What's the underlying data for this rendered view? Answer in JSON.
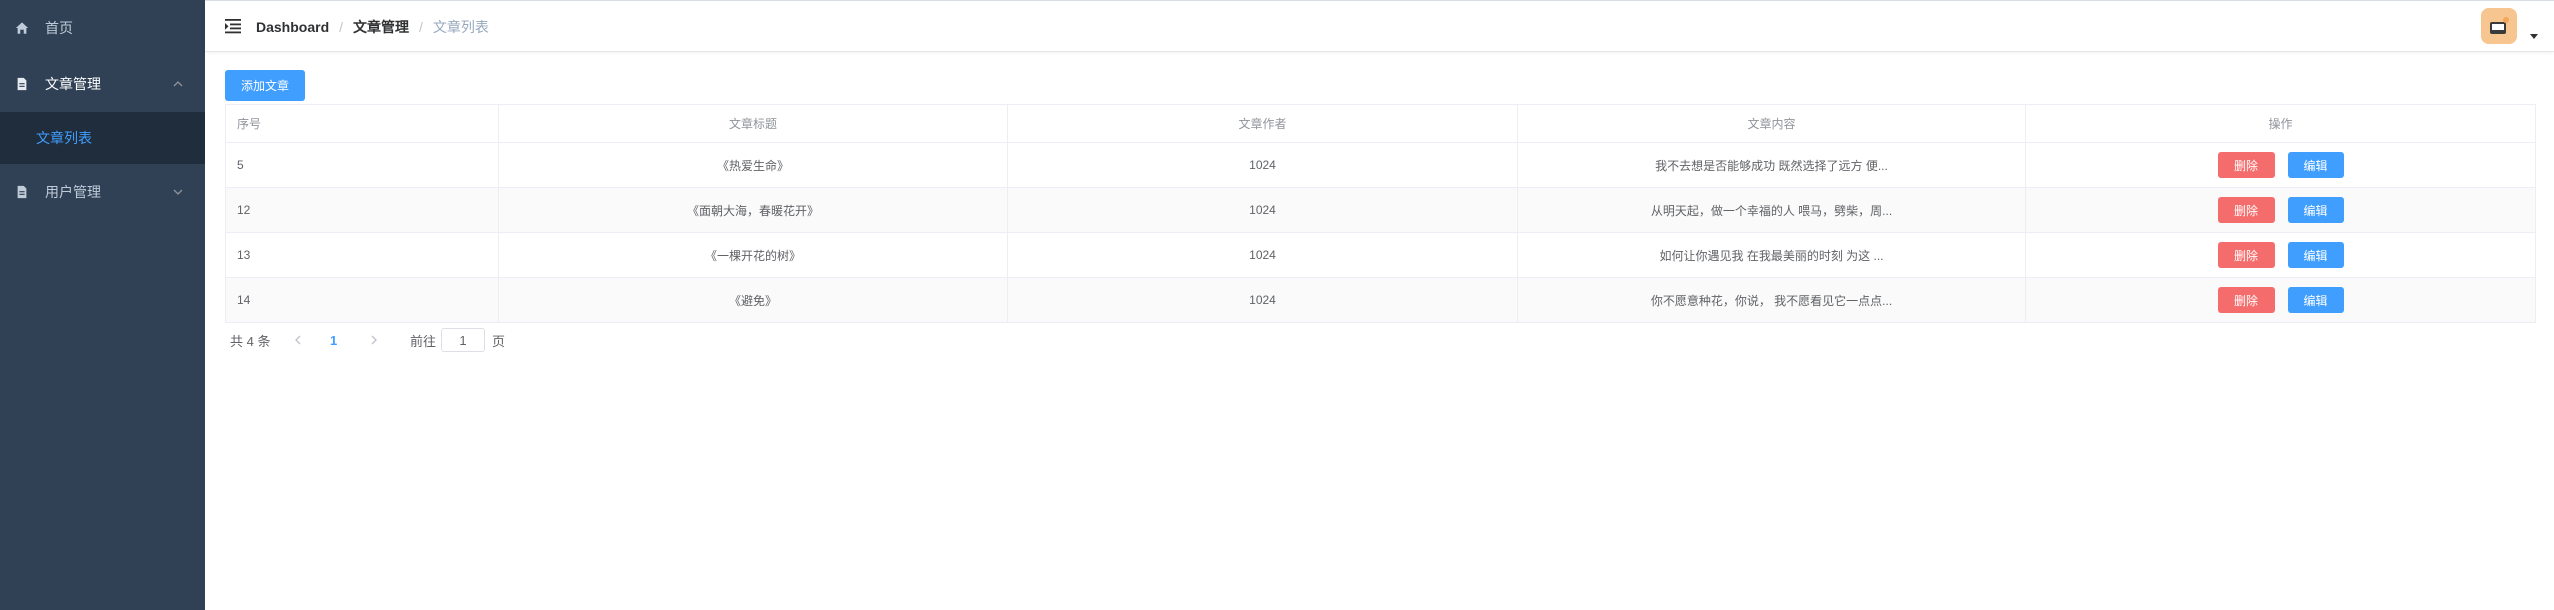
{
  "sidebar": {
    "items": [
      {
        "label": "首页",
        "icon": "home-icon"
      },
      {
        "label": "文章管理",
        "icon": "document-icon",
        "expanded": true,
        "children": [
          {
            "label": "文章列表",
            "active": true
          }
        ]
      },
      {
        "label": "用户管理",
        "icon": "document-icon",
        "expanded": false
      }
    ]
  },
  "header": {
    "breadcrumb": [
      "Dashboard",
      "文章管理",
      "文章列表"
    ],
    "separator": "/"
  },
  "toolbar": {
    "add_label": "添加文章"
  },
  "table": {
    "columns": [
      "序号",
      "文章标题",
      "文章作者",
      "文章内容",
      "操作"
    ],
    "rows": [
      {
        "id": "5",
        "title": "《热爱生命》",
        "author": "1024",
        "content": "我不去想是否能够成功 既然选择了远方 便..."
      },
      {
        "id": "12",
        "title": "《面朝大海，春暖花开》",
        "author": "1024",
        "content": "从明天起，做一个幸福的人 喂马，劈柴，周..."
      },
      {
        "id": "13",
        "title": "《一棵开花的树》",
        "author": "1024",
        "content": "如何让你遇见我 在我最美丽的时刻 为这 ..."
      },
      {
        "id": "14",
        "title": "《避免》",
        "author": "1024",
        "content": "你不愿意种花，你说， 我不愿看见它一点点..."
      }
    ]
  },
  "row_actions": {
    "delete_label": "删除",
    "edit_label": "编辑"
  },
  "pagination": {
    "total_text": "共 4 条",
    "current_page": "1",
    "jump_prefix": "前往",
    "jump_value": "1",
    "jump_suffix": "页"
  },
  "colors": {
    "sidebar_bg": "#304156",
    "submenu_bg": "#1f2d3d",
    "primary": "#409eff",
    "danger": "#f56c6c",
    "avatar_bg": "#f7c58f"
  }
}
